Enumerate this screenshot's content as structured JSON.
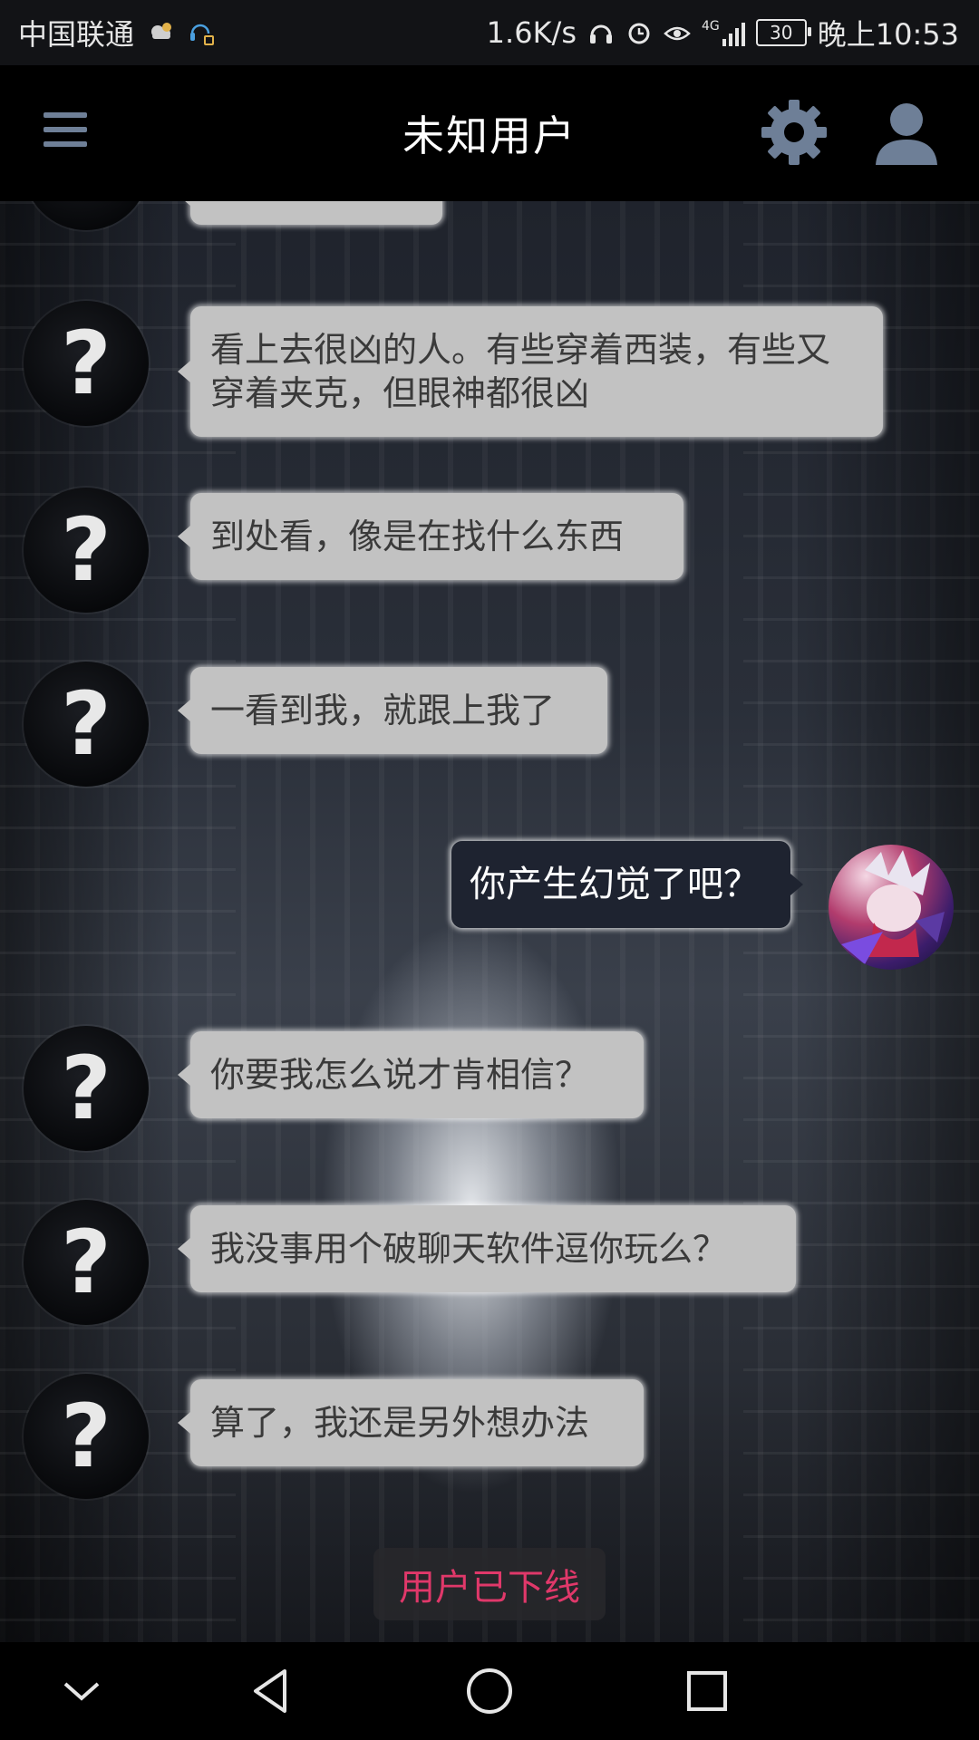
{
  "status_bar": {
    "carrier": "中国联通",
    "net_speed": "1.6K/s",
    "signal_label": "4G",
    "battery": "30",
    "time": "晚上10:53"
  },
  "header": {
    "title": "未知用户",
    "menu_icon": "menu-icon",
    "settings_icon": "gear-icon",
    "profile_icon": "user-icon"
  },
  "messages": [
    {
      "from": "other",
      "text": "看上去很凶的人。有些穿着西装，有些又穿着夹克，但眼神都很凶"
    },
    {
      "from": "other",
      "text": "到处看，像是在找什么东西"
    },
    {
      "from": "other",
      "text": "一看到我，就跟上我了"
    },
    {
      "from": "me",
      "text": "你产生幻觉了吧？"
    },
    {
      "from": "other",
      "text": "你要我怎么说才肯相信？"
    },
    {
      "from": "other",
      "text": "我没事用个破聊天软件逗你玩么？"
    },
    {
      "from": "other",
      "text": "算了，我还是另外想办法"
    }
  ],
  "avatar_unknown_symbol": "?",
  "status_toast": "用户已下线",
  "colors": {
    "bubble_in": "#c2c2c2",
    "bubble_out": "#1e2330",
    "toast_text": "#e0386a",
    "icon_blue": "#6e7f97"
  }
}
